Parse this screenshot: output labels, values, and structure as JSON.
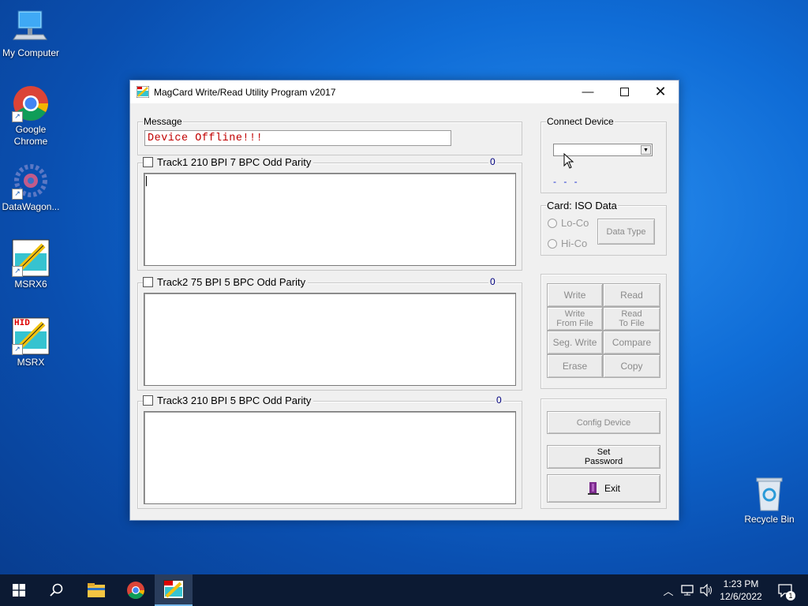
{
  "desktop": {
    "icons": [
      {
        "label": "My Computer"
      },
      {
        "label": "Google Chrome"
      },
      {
        "label": "DataWagon..."
      },
      {
        "label": "MSRX6"
      },
      {
        "label": "MSRX"
      },
      {
        "label": "Recycle Bin"
      }
    ]
  },
  "window": {
    "title": "MagCard Write/Read Utility Program  v2017",
    "message_group": "Message",
    "message_text": "Device Offline!!!",
    "tracks": [
      {
        "label": "Track1   210 BPI  7 BPC  Odd Parity",
        "count": "0"
      },
      {
        "label": "Track2   75 BPI  5 BPC  Odd Parity",
        "count": "0"
      },
      {
        "label": "Track3   210 BPI  5 BPC  Odd Parity",
        "count": "0"
      }
    ],
    "connect_group": "Connect Device",
    "connect_status": "- - -",
    "card_group": "Card: ISO Data",
    "loco": "Lo-Co",
    "hico": "Hi-Co",
    "data_type": "Data Type",
    "buttons": {
      "write": "Write",
      "read": "Read",
      "write_from_file_1": "Write",
      "write_from_file_2": "From File",
      "read_to_file_1": "Read",
      "read_to_file_2": "To File",
      "seg_write": "Seg. Write",
      "compare": "Compare",
      "erase": "Erase",
      "copy": "Copy",
      "config_device": "Config Device",
      "set_password_1": "Set",
      "set_password_2": "Password",
      "exit": "Exit"
    }
  },
  "taskbar": {
    "time": "1:23 PM",
    "date": "12/6/2022",
    "notifications": "1"
  }
}
